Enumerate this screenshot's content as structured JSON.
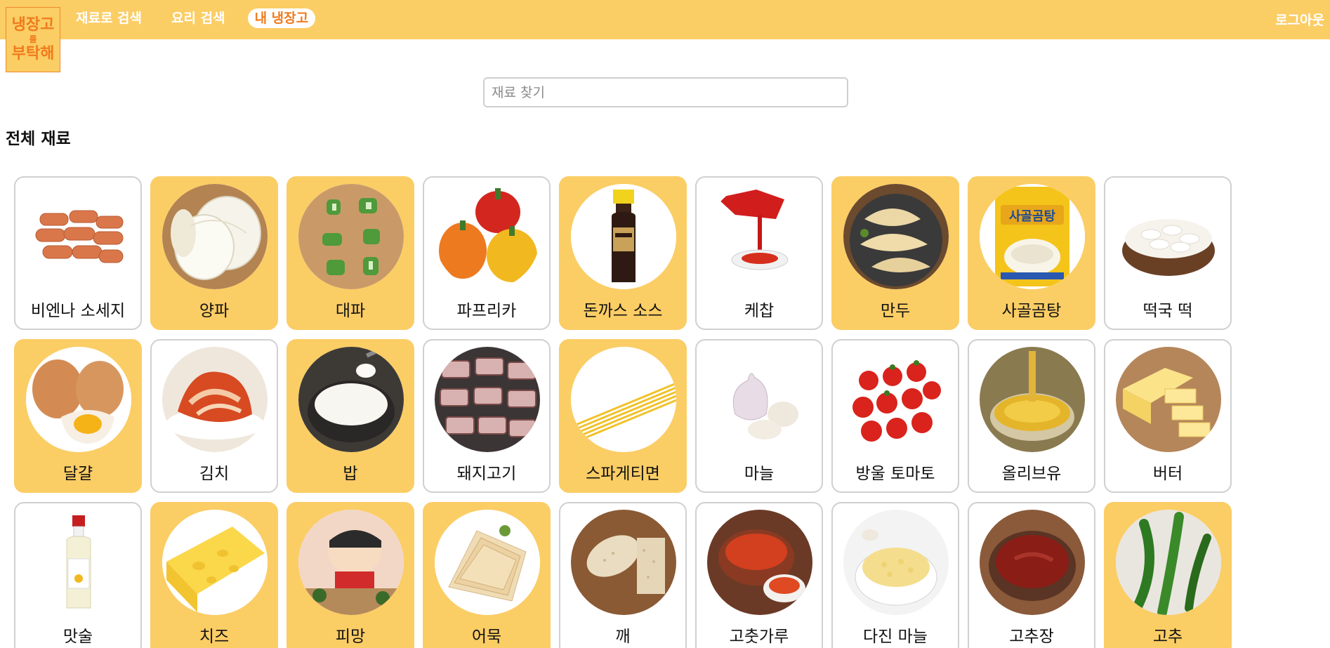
{
  "logo": {
    "line1": "냉장고",
    "line2": "를",
    "line3": "부탁해"
  },
  "nav": [
    {
      "label": "재료로 검색",
      "active": false
    },
    {
      "label": "요리 검색",
      "active": false
    },
    {
      "label": "내 냉장고",
      "active": true
    }
  ],
  "logout_label": "로그아웃",
  "search": {
    "placeholder": "재료 찾기",
    "value": ""
  },
  "section_title": "전체 재료",
  "colors": {
    "accent": "#fbcd65",
    "logo_text": "#f07b1d",
    "card_border": "#d0d0d0"
  },
  "ingredients": [
    {
      "name": "비엔나 소세지",
      "selected": false,
      "icon": "sausage-icon"
    },
    {
      "name": "양파",
      "selected": true,
      "icon": "onion-icon"
    },
    {
      "name": "대파",
      "selected": true,
      "icon": "green-onion-icon"
    },
    {
      "name": "파프리카",
      "selected": false,
      "icon": "paprika-icon"
    },
    {
      "name": "돈까스 소스",
      "selected": true,
      "icon": "sauce-bottle-icon"
    },
    {
      "name": "케찹",
      "selected": false,
      "icon": "ketchup-icon"
    },
    {
      "name": "만두",
      "selected": true,
      "icon": "dumpling-icon"
    },
    {
      "name": "사골곰탕",
      "selected": true,
      "icon": "bone-soup-pack-icon"
    },
    {
      "name": "떡국 떡",
      "selected": false,
      "icon": "rice-cake-icon"
    },
    {
      "name": "달걀",
      "selected": true,
      "icon": "egg-icon"
    },
    {
      "name": "김치",
      "selected": false,
      "icon": "kimchi-icon"
    },
    {
      "name": "밥",
      "selected": true,
      "icon": "rice-icon"
    },
    {
      "name": "돼지고기",
      "selected": false,
      "icon": "pork-icon"
    },
    {
      "name": "스파게티면",
      "selected": true,
      "icon": "spaghetti-icon"
    },
    {
      "name": "마늘",
      "selected": false,
      "icon": "garlic-icon"
    },
    {
      "name": "방울 토마토",
      "selected": false,
      "icon": "cherry-tomato-icon"
    },
    {
      "name": "올리브유",
      "selected": false,
      "icon": "olive-oil-icon"
    },
    {
      "name": "버터",
      "selected": false,
      "icon": "butter-icon"
    },
    {
      "name": "맛술",
      "selected": false,
      "icon": "cooking-wine-icon"
    },
    {
      "name": "치즈",
      "selected": true,
      "icon": "cheese-icon"
    },
    {
      "name": "피망",
      "selected": true,
      "icon": "cartoon-icon"
    },
    {
      "name": "어묵",
      "selected": true,
      "icon": "fish-cake-icon"
    },
    {
      "name": "깨",
      "selected": false,
      "icon": "sesame-icon"
    },
    {
      "name": "고춧가루",
      "selected": false,
      "icon": "chili-powder-icon"
    },
    {
      "name": "다진 마늘",
      "selected": false,
      "icon": "minced-garlic-icon"
    },
    {
      "name": "고추장",
      "selected": false,
      "icon": "gochujang-icon"
    },
    {
      "name": "고추",
      "selected": true,
      "icon": "chili-pepper-icon"
    }
  ]
}
